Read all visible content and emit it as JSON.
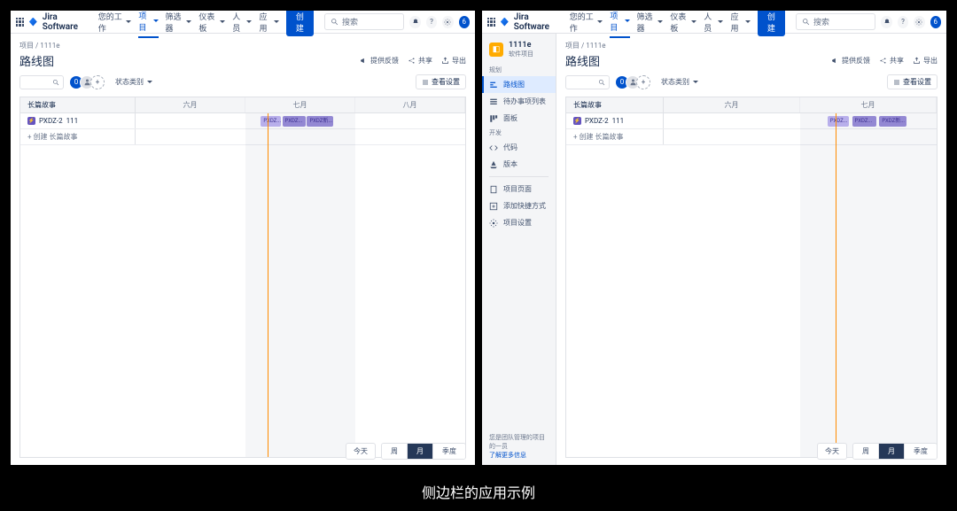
{
  "caption": "侧边栏的应用示例",
  "brand": "Jira Software",
  "nav": {
    "your_work": "您的工作",
    "projects": "项目",
    "filters": "筛选器",
    "dashboards": "仪表板",
    "people": "人员",
    "apps": "应用",
    "create_button": "创建"
  },
  "search_placeholder": "搜索",
  "user_initial": "6",
  "breadcrumb": "项目 / 1111e",
  "page_title": "路线图",
  "title_actions": {
    "feedback": "提供反馈",
    "share": "共享",
    "export": "导出"
  },
  "controls": {
    "avatar_count": "0",
    "status_category": "状态类别",
    "view_settings": "查看设置"
  },
  "roadmap": {
    "side_header": "长篇故事",
    "months_three": [
      "六月",
      "七月",
      "八月"
    ],
    "months_two": [
      "六月",
      "七月"
    ],
    "epic_key": "PXDZ-2",
    "epic_title": "111",
    "create_row": "+ 创建 长篇故事",
    "bar_labels": [
      "PXDZ...",
      "PXDZ...",
      "PXDZ新..."
    ],
    "footer": {
      "today": "今天",
      "week": "周",
      "month": "月",
      "quarter": "季度"
    }
  },
  "sidebar": {
    "project_name": "1111e",
    "project_type": "软件项目",
    "group_plan": "规划",
    "roadmap": "路线图",
    "backlog": "待办事项列表",
    "board": "面板",
    "group_dev": "开发",
    "code": "代码",
    "releases": "版本",
    "project_pages": "项目页面",
    "add_shortcut": "添加快捷方式",
    "project_settings": "项目设置",
    "footer_msg": "您是团队管理的项目的一员",
    "footer_link": "了解更多信息"
  }
}
